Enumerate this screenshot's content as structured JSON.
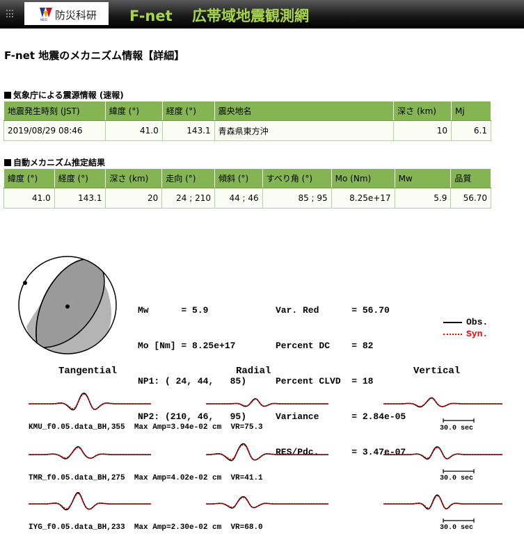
{
  "header": {
    "logo_text": "防災科研",
    "logo_sub": "NIED",
    "title": "F-net　 広帯域地震観測網"
  },
  "page_title": "F-net 地震のメカニズム情報【詳細】",
  "jma_section": {
    "heading": "気象庁による震源情報 (速報)",
    "columns": [
      "地震発生時刻 (JST)",
      "緯度 (°)",
      "経度 (°)",
      "震央地名",
      "深さ (km)",
      "Mj"
    ],
    "row": [
      "2019/08/29 08:46",
      "41.0",
      "143.1",
      "青森県東方沖",
      "10",
      "6.1"
    ]
  },
  "mech_section": {
    "heading": "自動メカニズム推定結果",
    "columns": [
      "緯度 (°)",
      "経度 (°)",
      "深さ (km)",
      "走向 (°)",
      "傾斜 (°)",
      "すべり角 (°)",
      "Mo (Nm)",
      "Mw",
      "品質"
    ],
    "row": [
      "41.0",
      "143.1",
      "20",
      "24 ; 210",
      "44 ; 46",
      "85 ; 95",
      "8.25e+17",
      "5.9",
      "56.70"
    ]
  },
  "solution": {
    "left_lines": [
      "Mw      = 5.9",
      "Mo [Nm] = 8.25e+17",
      "NP1: ( 24, 44,   85)",
      "NP2: (210, 46,   95)"
    ],
    "right_lines": [
      "Var. Red      = 56.70",
      "Percent DC    = 82",
      "Percent CLVD  = 18",
      "Variance      = 2.84e-05",
      "RES/Pdc.      = 3.47e-07"
    ],
    "legend_obs": "Obs.",
    "legend_syn": "Syn.",
    "obs_color": "#000000",
    "syn_color": "#ff0000"
  },
  "waveforms": {
    "components": [
      "Tangential",
      "Radial",
      "Vertical"
    ],
    "stations": [
      "KMU_f0.05.data_BH,355  Max Amp=3.94e-02 cm  VR=75.3",
      "TMR_f0.05.data_BH,275  Max Amp=4.02e-02 cm  VR=41.1",
      "IYG_f0.05.data_BH,233  Max Amp=2.30e-02 cm  VR=68.0"
    ],
    "scale_label": "30.0 sec"
  }
}
